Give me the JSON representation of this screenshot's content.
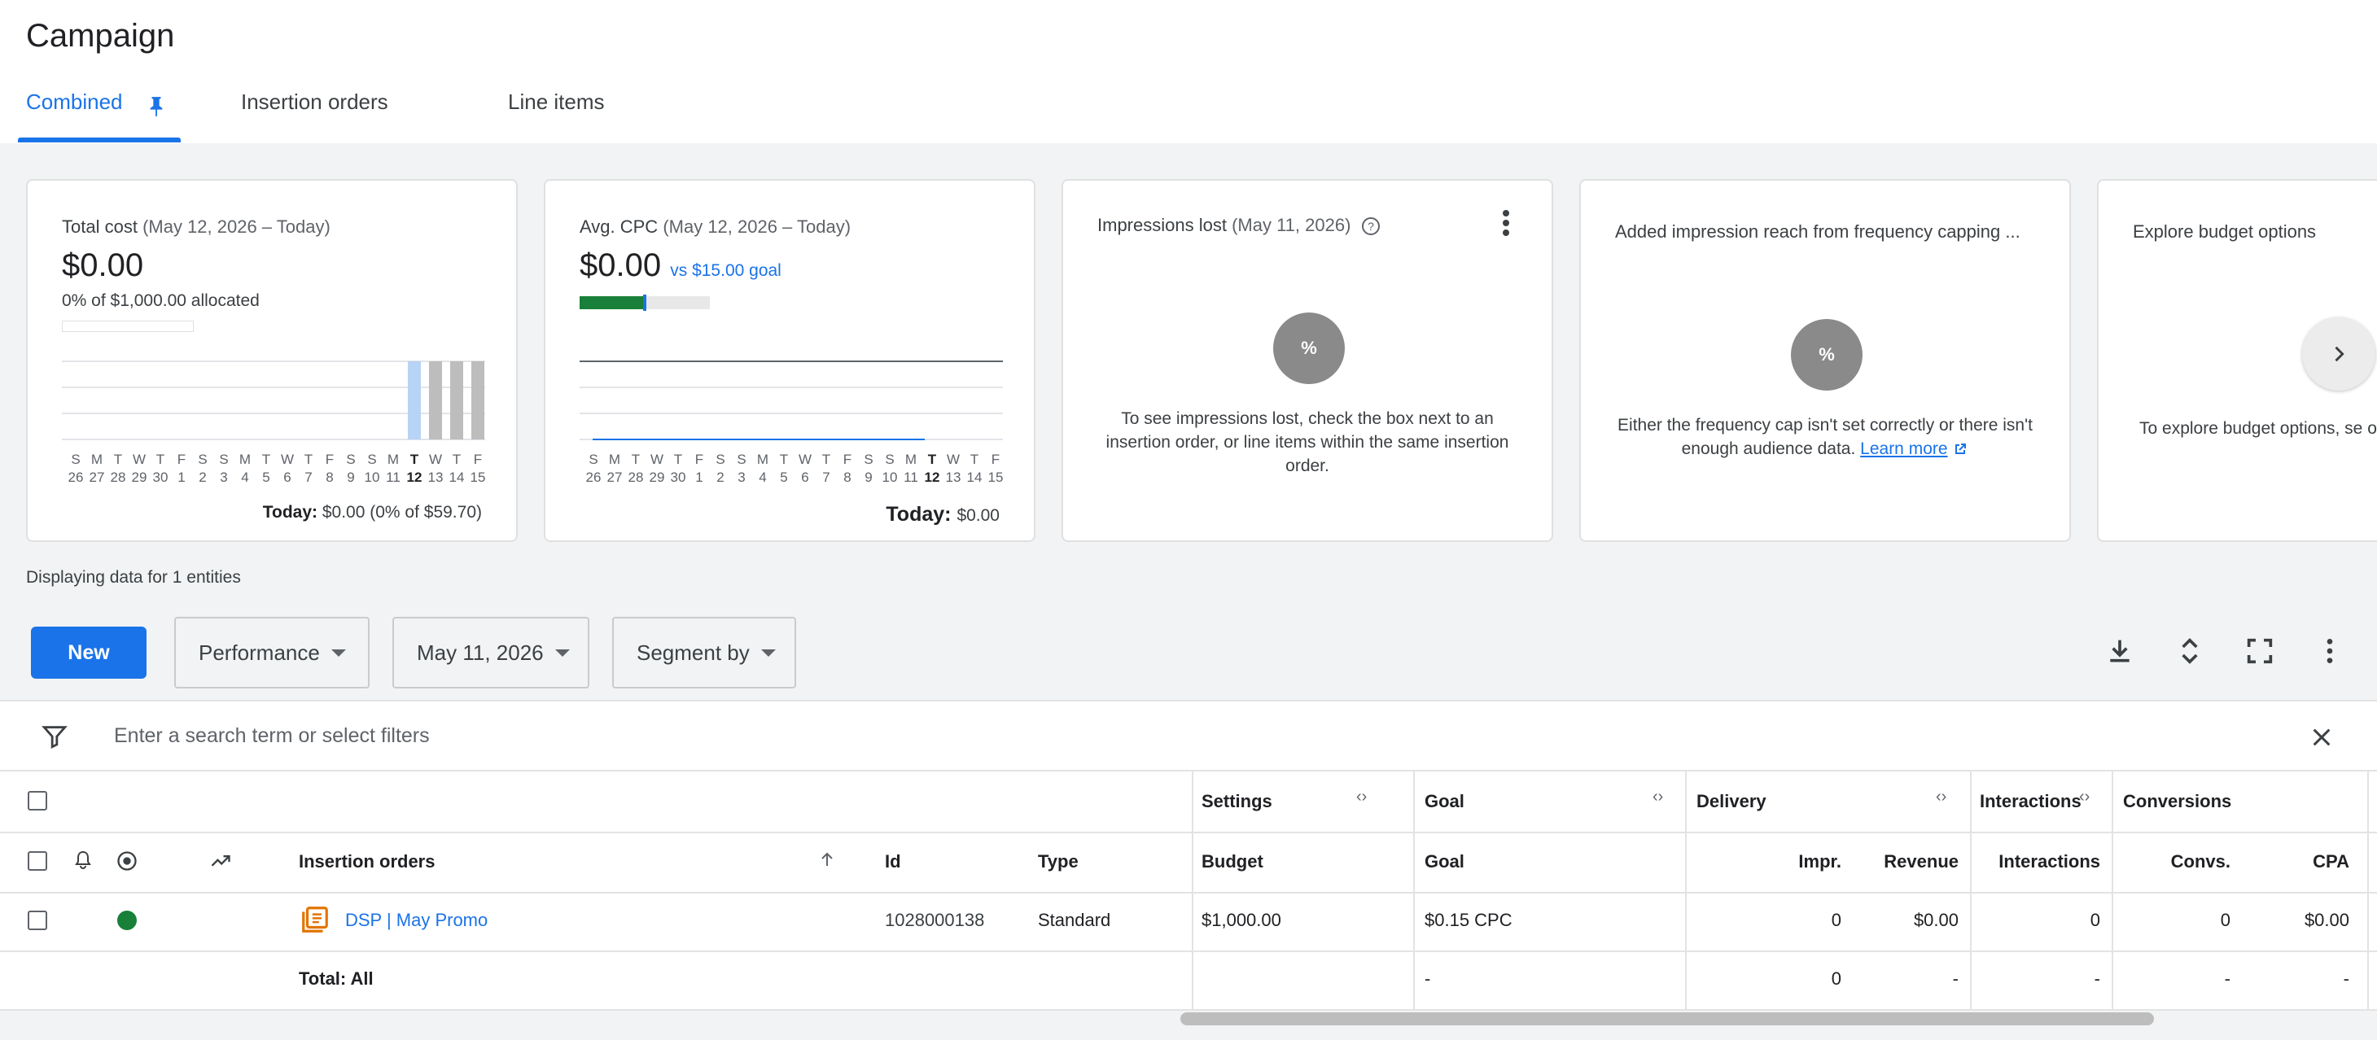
{
  "header": {
    "title": "Campaign",
    "tabs": [
      {
        "label": "Combined",
        "active": true
      },
      {
        "label": "Insertion orders",
        "active": false
      },
      {
        "label": "Line items",
        "active": false
      }
    ]
  },
  "cards": {
    "total_cost": {
      "title": "Total cost",
      "range": "(May 12, 2026 – Today)",
      "value": "$0.00",
      "allocated": "0% of $1,000.00 allocated",
      "today_label": "Today:",
      "today_value": "$0.00 (0% of $59.70)",
      "day_letters": [
        "S",
        "M",
        "T",
        "W",
        "T",
        "F",
        "S",
        "S",
        "M",
        "T",
        "W",
        "T",
        "F",
        "S",
        "S",
        "M",
        "T",
        "W",
        "T",
        "F"
      ],
      "day_numbers": [
        "26",
        "27",
        "28",
        "29",
        "30",
        "1",
        "2",
        "3",
        "4",
        "5",
        "6",
        "7",
        "8",
        "9",
        "10",
        "11",
        "12",
        "13",
        "14",
        "15"
      ],
      "bar_levels": [
        0,
        0,
        0,
        0,
        0,
        0,
        0,
        0,
        0,
        0,
        0,
        0,
        0,
        0,
        0,
        0,
        1,
        1,
        1,
        1
      ],
      "highlight_bar_index": 16
    },
    "avg_cpc": {
      "title": "Avg. CPC",
      "range": "(May 12, 2026 – Today)",
      "value": "$0.00",
      "goal": "vs $15.00 goal",
      "progress_fraction": 0.5,
      "today_label": "Today:",
      "today_value": "$0.00",
      "day_letters": [
        "S",
        "M",
        "T",
        "W",
        "T",
        "F",
        "S",
        "S",
        "M",
        "T",
        "W",
        "T",
        "F",
        "S",
        "S",
        "M",
        "T",
        "W",
        "T",
        "F"
      ],
      "day_numbers": [
        "26",
        "27",
        "28",
        "29",
        "30",
        "1",
        "2",
        "3",
        "4",
        "5",
        "6",
        "7",
        "8",
        "9",
        "10",
        "11",
        "12",
        "13",
        "14",
        "15"
      ]
    },
    "impressions_lost": {
      "title": "Impressions lost",
      "range": "(May 11, 2026)",
      "circle": "%",
      "description": "To see impressions lost, check the box next to an insertion order, or line items within the same insertion order."
    },
    "frequency": {
      "title": "Added impression reach from frequency capping ...",
      "circle": "%",
      "description": "Either the frequency cap isn't set correctly or there isn't enough audience data.",
      "link": "Learn more"
    },
    "budget": {
      "title": "Explore budget options",
      "description": "To explore budget options, se order."
    }
  },
  "display_info": "Displaying data for 1 entities",
  "toolbar": {
    "new_label": "New",
    "performance": "Performance",
    "date": "May 11, 2026",
    "segment": "Segment by"
  },
  "filter": {
    "placeholder": "Enter a search term or select filters"
  },
  "table": {
    "groups": {
      "settings": "Settings",
      "goal": "Goal",
      "delivery": "Delivery",
      "interactions": "Interactions",
      "conversions": "Conversions"
    },
    "columns": {
      "name": "Insertion orders",
      "id": "Id",
      "type": "Type",
      "budget": "Budget",
      "goal": "Goal",
      "impr": "Impr.",
      "revenue": "Revenue",
      "interactions": "Interactions",
      "convs": "Convs.",
      "cpa": "CPA"
    },
    "rows": [
      {
        "name": "DSP | May Promo",
        "id": "1028000138",
        "type": "Standard",
        "budget": "$1,000.00",
        "goal": "$0.15 CPC",
        "impr": "0",
        "revenue": "$0.00",
        "interactions": "0",
        "convs": "0",
        "cpa": "$0.00",
        "status_color": "#188038"
      }
    ],
    "total": {
      "label": "Total: All",
      "goal": "-",
      "impr": "0",
      "revenue": "-",
      "interactions": "-",
      "convs": "-",
      "cpa": "-"
    }
  }
}
